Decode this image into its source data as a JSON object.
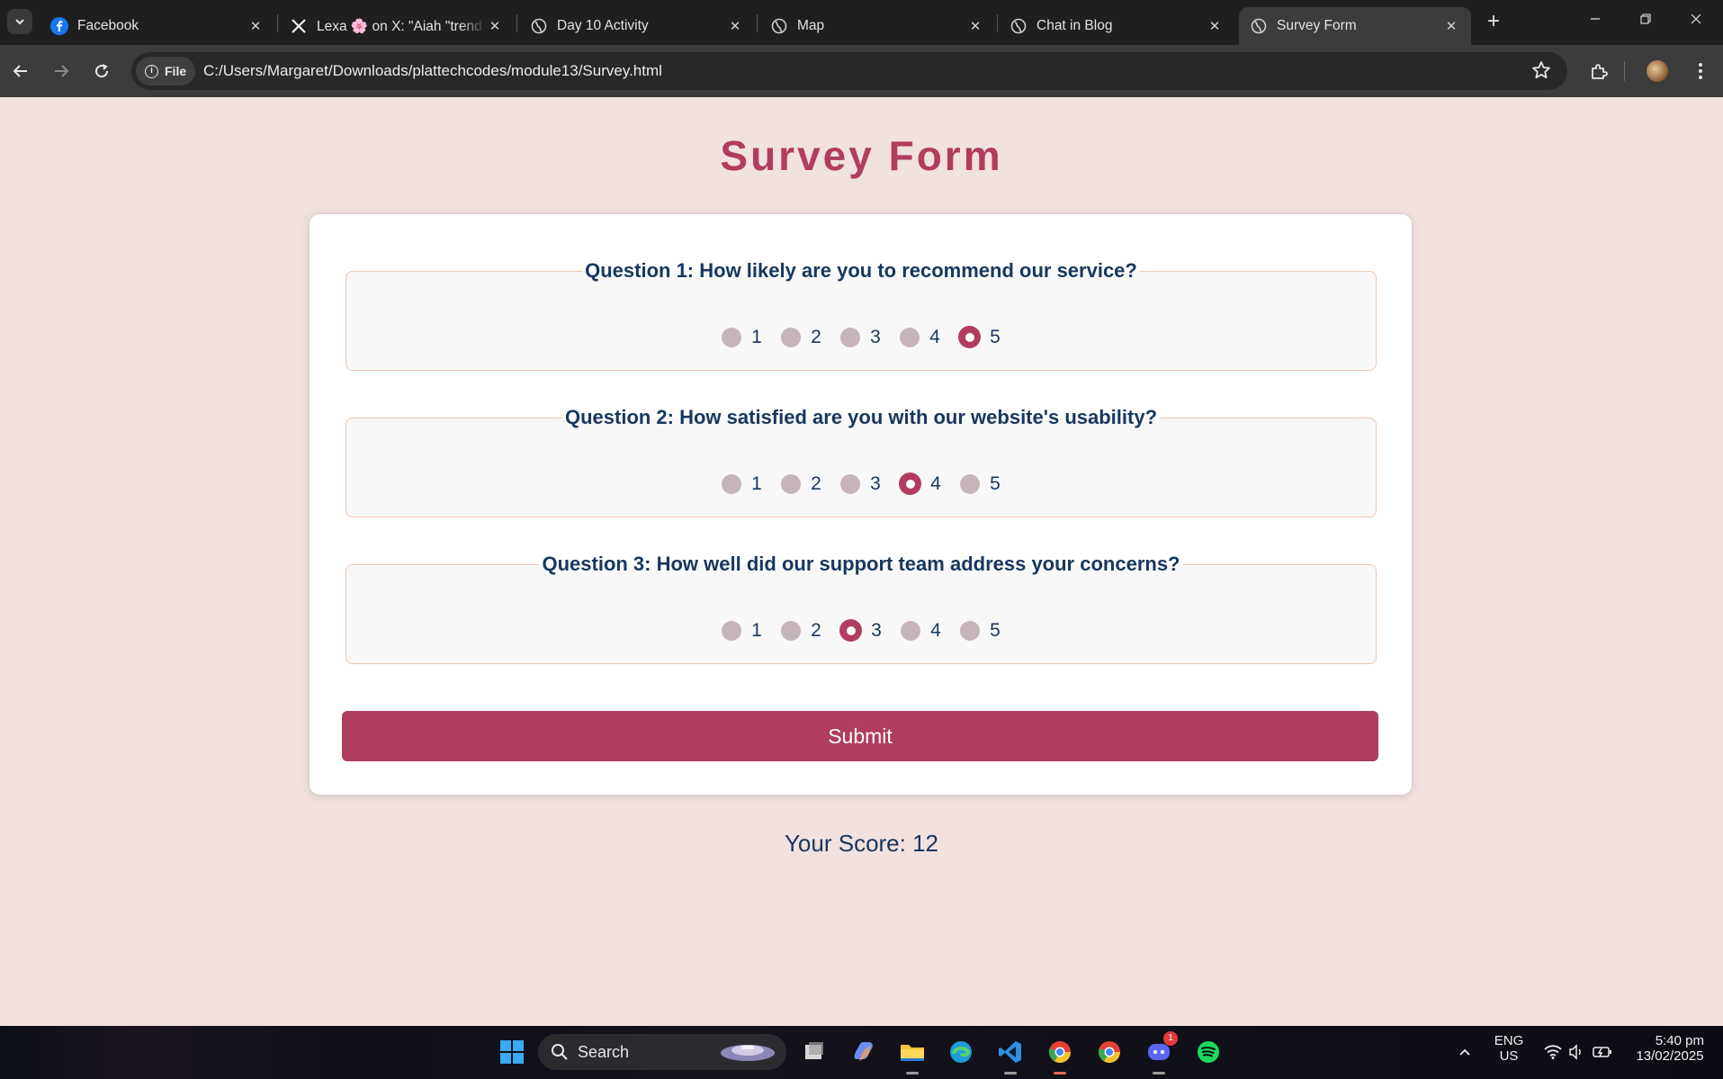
{
  "browser": {
    "tabs": [
      {
        "title": "Facebook",
        "icon": "facebook-icon"
      },
      {
        "title": "Lexa 🌸 on X: \"Aiah \"trend",
        "icon": "x-icon"
      },
      {
        "title": "Day 10 Activity",
        "icon": "globe-icon"
      },
      {
        "title": "Map",
        "icon": "globe-icon"
      },
      {
        "title": "Chat in Blog",
        "icon": "globe-icon"
      },
      {
        "title": "Survey Form",
        "icon": "globe-icon",
        "active": true
      }
    ],
    "site_chip": "File",
    "url": "C:/Users/Margaret/Downloads/plattechcodes/module13/Survey.html"
  },
  "page": {
    "title": "Survey Form",
    "questions": [
      {
        "legend": "Question 1: How likely are you to recommend our service?",
        "options": [
          "1",
          "2",
          "3",
          "4",
          "5"
        ],
        "selected": "5"
      },
      {
        "legend": "Question 2: How satisfied are you with our website's usability?",
        "options": [
          "1",
          "2",
          "3",
          "4",
          "5"
        ],
        "selected": "4"
      },
      {
        "legend": "Question 3: How well did our support team address your concerns?",
        "options": [
          "1",
          "2",
          "3",
          "4",
          "5"
        ],
        "selected": "3"
      }
    ],
    "submit_label": "Submit",
    "score_text": "Your Score: 12"
  },
  "taskbar": {
    "search_label": "Search",
    "language": "ENG",
    "region": "US",
    "time": "5:40 pm",
    "date": "13/02/2025",
    "discord_badge": "1"
  },
  "colors": {
    "accent": "#b13c5f",
    "question_text": "#17375e",
    "page_bg": "#f1e1df"
  }
}
